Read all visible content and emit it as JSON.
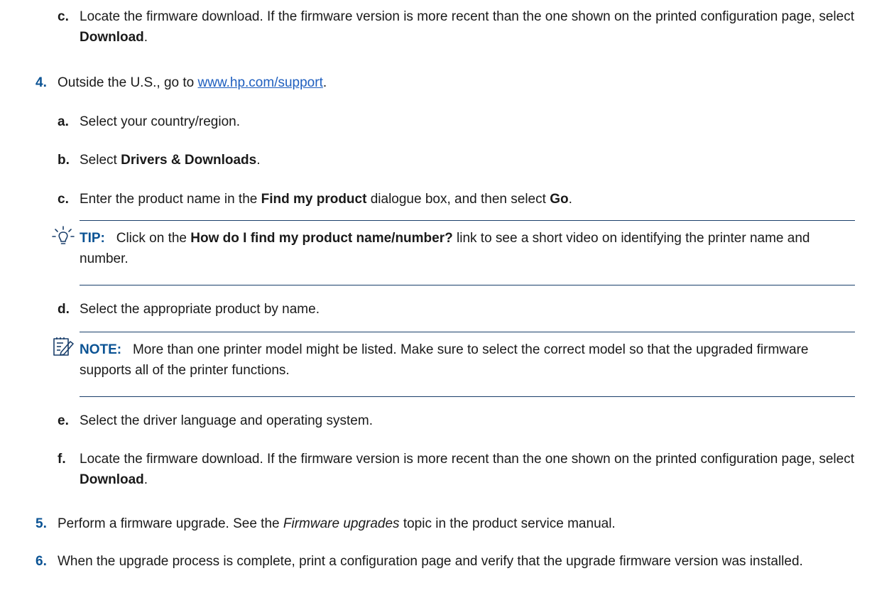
{
  "step_c_top": {
    "letter": "c.",
    "part1": "Locate the firmware download. If the firmware version is more recent than the one shown on the printed configuration page, select ",
    "bold": "Download",
    "part2": "."
  },
  "step4": {
    "num": "4.",
    "part1": "Outside the U.S., go to ",
    "link": "www.hp.com/support",
    "part2": "."
  },
  "step4a": {
    "letter": "a.",
    "text": "Select your country/region."
  },
  "step4b": {
    "letter": "b.",
    "part1": "Select ",
    "bold": "Drivers & Downloads",
    "part2": "."
  },
  "step4c": {
    "letter": "c.",
    "part1": "Enter the product name in the ",
    "bold1": "Find my product",
    "part2": " dialogue box, and then select ",
    "bold2": "Go",
    "part3": "."
  },
  "tip": {
    "icon": "lightbulb-icon",
    "label": "TIP:",
    "part1": "Click on the ",
    "bold": "How do I find my product name/number?",
    "part2": " link to see a short video on identifying the printer name and number."
  },
  "step4d": {
    "letter": "d.",
    "text": "Select the appropriate product by name."
  },
  "note": {
    "icon": "note-icon",
    "label": "NOTE:",
    "text": "More than one printer model might be listed. Make sure to select the correct model so that the upgraded firmware supports all of the printer functions."
  },
  "step4e": {
    "letter": "e.",
    "text": "Select the driver language and operating system."
  },
  "step4f": {
    "letter": "f.",
    "part1": "Locate the firmware download. If the firmware version is more recent than the one shown on the printed configuration page, select ",
    "bold": "Download",
    "part2": "."
  },
  "step5": {
    "num": "5.",
    "part1": "Perform a firmware upgrade. See the ",
    "italic": "Firmware upgrades",
    "part2": " topic in the product service manual."
  },
  "step6": {
    "num": "6.",
    "text": "When the upgrade process is complete, print a configuration page and verify that the upgrade firmware version was installed."
  },
  "colors": {
    "accent": "#0b5394",
    "link": "#1f5fbf",
    "rule": "#1a3f6b",
    "text": "#1a1a1a"
  }
}
